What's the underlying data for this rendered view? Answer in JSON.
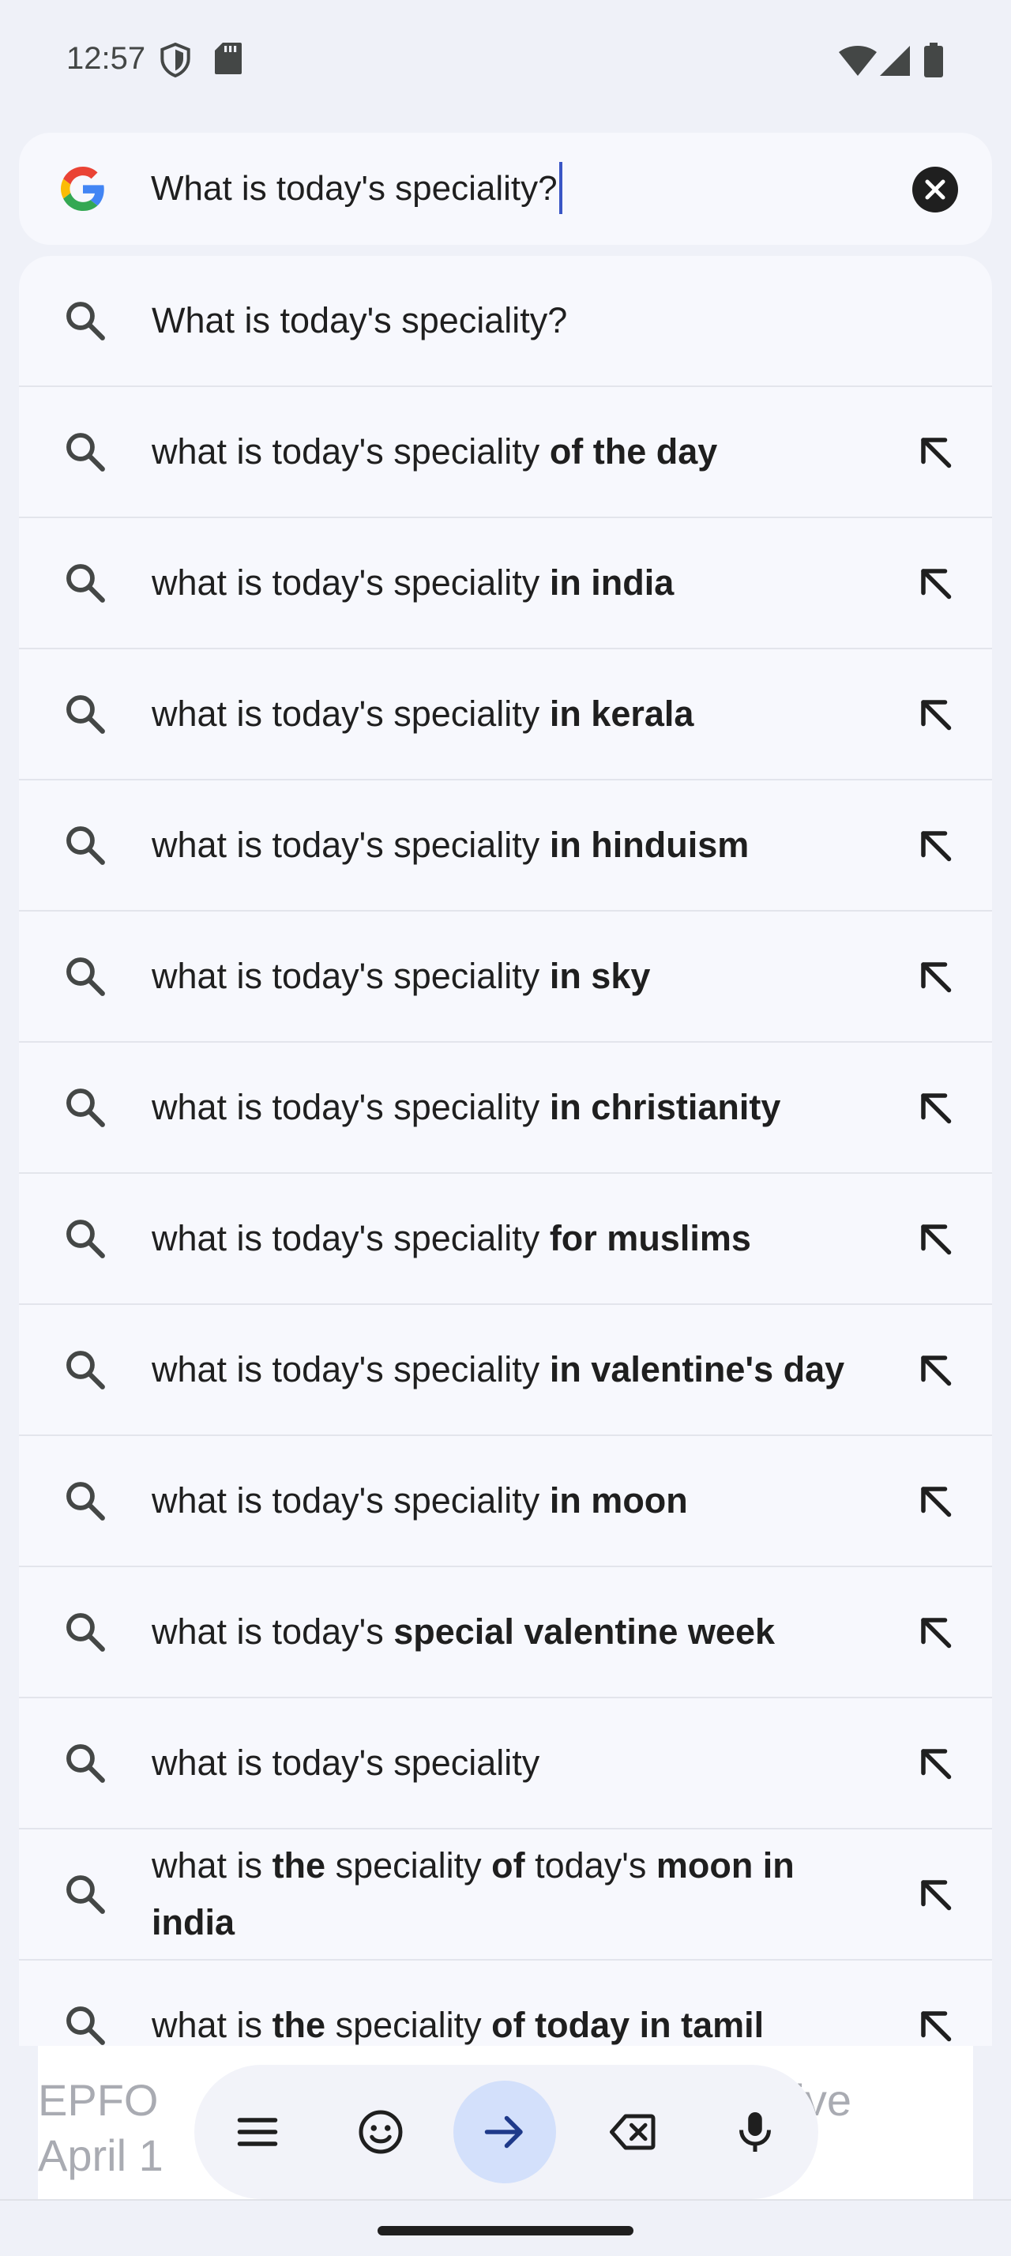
{
  "status_bar": {
    "time": "12:57",
    "icons": [
      "shield-icon",
      "sd-card-icon",
      "wifi-icon",
      "cellular-signal-icon",
      "battery-icon"
    ]
  },
  "search": {
    "query": "What is today's speciality?",
    "logo": "google-logo",
    "clear_icon": "close-circle-icon"
  },
  "suggestions": [
    {
      "parts": [
        {
          "t": "What is today's speciality?",
          "b": false
        }
      ],
      "has_arrow": false
    },
    {
      "parts": [
        {
          "t": "what is today's speciality ",
          "b": false
        },
        {
          "t": "of the day",
          "b": true
        }
      ],
      "has_arrow": true
    },
    {
      "parts": [
        {
          "t": "what is today's speciality ",
          "b": false
        },
        {
          "t": "in india",
          "b": true
        }
      ],
      "has_arrow": true
    },
    {
      "parts": [
        {
          "t": "what is today's speciality ",
          "b": false
        },
        {
          "t": "in kerala",
          "b": true
        }
      ],
      "has_arrow": true
    },
    {
      "parts": [
        {
          "t": "what is today's speciality ",
          "b": false
        },
        {
          "t": "in hinduism",
          "b": true
        }
      ],
      "has_arrow": true
    },
    {
      "parts": [
        {
          "t": "what is today's speciality ",
          "b": false
        },
        {
          "t": "in sky",
          "b": true
        }
      ],
      "has_arrow": true
    },
    {
      "parts": [
        {
          "t": "what is today's speciality ",
          "b": false
        },
        {
          "t": "in christianity",
          "b": true
        }
      ],
      "has_arrow": true
    },
    {
      "parts": [
        {
          "t": "what is today's speciality ",
          "b": false
        },
        {
          "t": "for muslims",
          "b": true
        }
      ],
      "has_arrow": true
    },
    {
      "parts": [
        {
          "t": "what is today's speciality ",
          "b": false
        },
        {
          "t": "in valentine's day",
          "b": true
        }
      ],
      "has_arrow": true
    },
    {
      "parts": [
        {
          "t": "what is today's speciality ",
          "b": false
        },
        {
          "t": "in moon",
          "b": true
        }
      ],
      "has_arrow": true
    },
    {
      "parts": [
        {
          "t": "what is today's ",
          "b": false
        },
        {
          "t": "special valentine week",
          "b": true
        }
      ],
      "has_arrow": true
    },
    {
      "parts": [
        {
          "t": "what is today's speciality",
          "b": false
        }
      ],
      "has_arrow": true
    },
    {
      "parts": [
        {
          "t": "what is ",
          "b": false
        },
        {
          "t": "the",
          "b": true
        },
        {
          "t": " speciality ",
          "b": false
        },
        {
          "t": "of",
          "b": true
        },
        {
          "t": " today's ",
          "b": false
        },
        {
          "t": "moon in india",
          "b": true
        }
      ],
      "has_arrow": true
    },
    {
      "parts": [
        {
          "t": "what is ",
          "b": false
        },
        {
          "t": "the",
          "b": true
        },
        {
          "t": " speciality ",
          "b": false
        },
        {
          "t": "of today in tamil",
          "b": true
        }
      ],
      "has_arrow": true
    }
  ],
  "keyboard": {
    "background_text": "EPFO                                                 ctive\nApril 1",
    "toolbar": [
      {
        "name": "menu-icon",
        "label": "Menu"
      },
      {
        "name": "emoji-icon",
        "label": "Emoji"
      },
      {
        "name": "arrow-right-icon",
        "label": "Go",
        "active": true
      },
      {
        "name": "backspace-icon",
        "label": "Delete"
      },
      {
        "name": "microphone-icon",
        "label": "Voice"
      }
    ]
  },
  "colors": {
    "background": "#eff1f8",
    "row": "#f7f8fd",
    "accent": "#3a56c5",
    "active_button": "#d3e0fb",
    "text": "#1f1f1f"
  }
}
